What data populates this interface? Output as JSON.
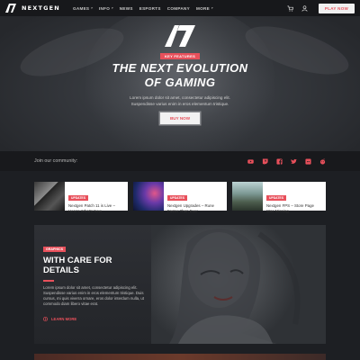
{
  "nav": {
    "brand": "NEXTGEN",
    "menu": [
      {
        "label": "GAMES",
        "has_caret": true
      },
      {
        "label": "INFO",
        "has_caret": true
      },
      {
        "label": "NEWS",
        "has_caret": false
      },
      {
        "label": "ESPORTS",
        "has_caret": false
      },
      {
        "label": "COMPANY",
        "has_caret": false
      },
      {
        "label": "MORE",
        "has_caret": true
      }
    ],
    "icons": [
      "cart-icon",
      "user-icon"
    ],
    "cta": "PLAY NOW"
  },
  "hero": {
    "badge": "KEY FEATURES",
    "title_line1": "THE NEXT EVOLUTION",
    "title_line2": "OF GAMING",
    "text_line1": "Lorem ipsum dolor sit amet, consectetur adipiscing elit.",
    "text_line2": "Suspendisse varius enim in eros elementum tristique.",
    "button": "BUY NOW"
  },
  "community": {
    "label": "Join our community:",
    "socials": [
      "youtube-icon",
      "twitch-icon",
      "facebook-icon",
      "twitter-icon",
      "discord-icon",
      "reddit-icon"
    ]
  },
  "news": [
    {
      "tag": "UPDATES",
      "title": "Nextgen Patch 11 is Live – Here's What's New"
    },
    {
      "tag": "UPDATES",
      "title": "Nextgen Upgrades – Rune Faster Than Ever"
    },
    {
      "tag": "UPDATES",
      "title": "Nextgen FPS – Store Page Was Missing"
    }
  ],
  "feature": {
    "tag": "GRAPHICS",
    "title": "WITH CARE FOR DETAILS",
    "text": "Lorem ipsum dolor sit amet, consectetur adipiscing elit. Suspendisse varius enim in eros elementum tristique. Duis cursus, mi quis viverra ornare, eros dolor interdum nulla, ut commodo diam libero vitae erat.",
    "link": "LEARN MORE"
  },
  "colors": {
    "accent": "#e8505b",
    "background": "#1d1f23"
  }
}
